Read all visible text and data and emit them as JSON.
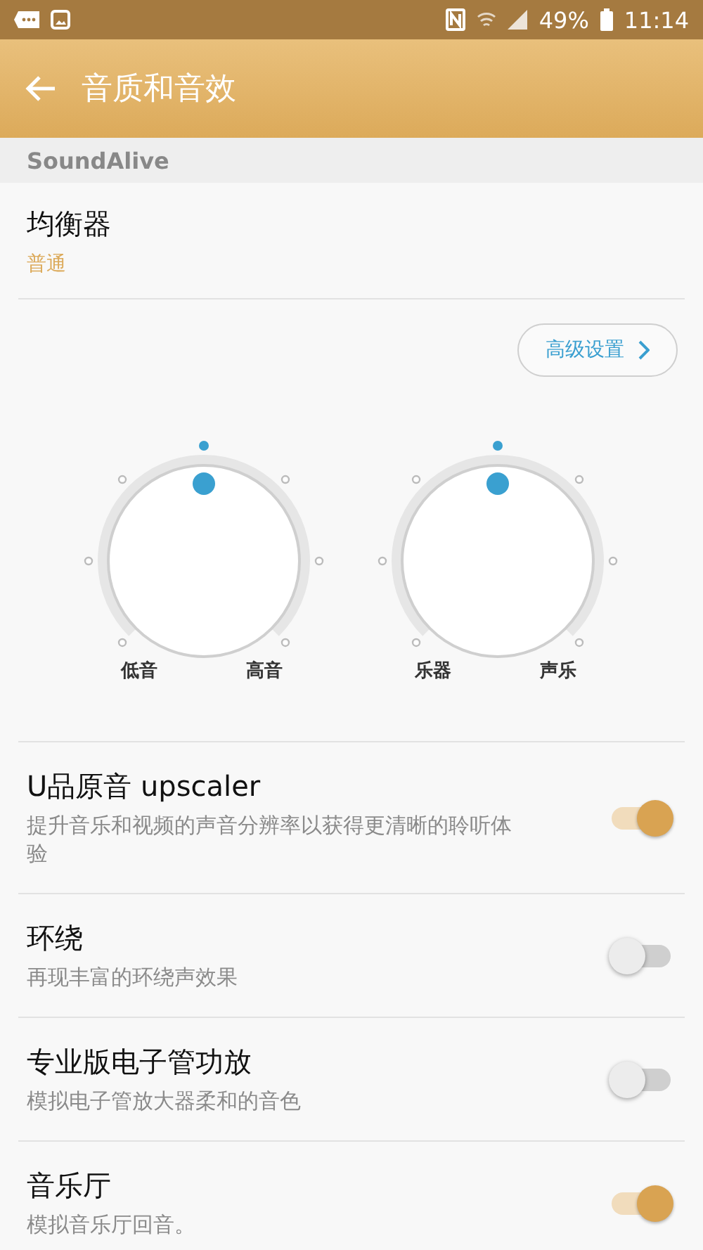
{
  "status_bar": {
    "battery": "49%",
    "time": "11:14"
  },
  "app_bar": {
    "title": "音质和音效"
  },
  "section_header": "SoundAlive",
  "equalizer": {
    "title": "均衡器",
    "value": "普通"
  },
  "advanced_button": "高级设置",
  "knobs": [
    {
      "left_label": "低音",
      "right_label": "高音"
    },
    {
      "left_label": "乐器",
      "right_label": "声乐"
    }
  ],
  "settings": [
    {
      "title": "U品原音 upscaler",
      "description": "提升音乐和视频的声音分辨率以获得更清晰的聆听体验",
      "on": true
    },
    {
      "title": "环绕",
      "description": "再现丰富的环绕声效果",
      "on": false
    },
    {
      "title": "专业版电子管功放",
      "description": "模拟电子管放大器柔和的音色",
      "on": false
    },
    {
      "title": "音乐厅",
      "description": "模拟音乐厅回音。",
      "on": true
    }
  ]
}
